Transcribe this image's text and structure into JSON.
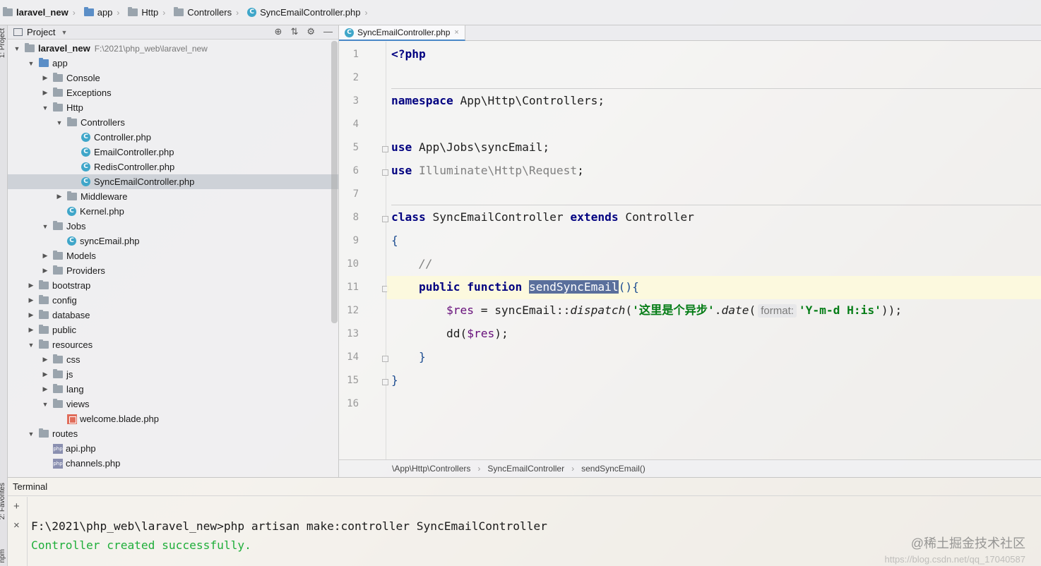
{
  "navbar": {
    "items": [
      "laravel_new",
      "app",
      "Http",
      "Controllers",
      "SyncEmailController.php"
    ]
  },
  "stripe": {
    "top_label": "1: Project",
    "bottom_label": "2: Favorites",
    "bottom_label2": "npm"
  },
  "project": {
    "title": "Project",
    "root_label": "laravel_new",
    "root_path": "F:\\2021\\php_web\\laravel_new",
    "tree": [
      {
        "label": "app",
        "depth": 1,
        "kind": "folder-blue",
        "open": true
      },
      {
        "label": "Console",
        "depth": 2,
        "kind": "folder",
        "open": false
      },
      {
        "label": "Exceptions",
        "depth": 2,
        "kind": "folder",
        "open": false
      },
      {
        "label": "Http",
        "depth": 2,
        "kind": "folder",
        "open": true
      },
      {
        "label": "Controllers",
        "depth": 3,
        "kind": "folder",
        "open": true
      },
      {
        "label": "Controller.php",
        "depth": 4,
        "kind": "php"
      },
      {
        "label": "EmailController.php",
        "depth": 4,
        "kind": "php"
      },
      {
        "label": "RedisController.php",
        "depth": 4,
        "kind": "php"
      },
      {
        "label": "SyncEmailController.php",
        "depth": 4,
        "kind": "php",
        "selected": true
      },
      {
        "label": "Middleware",
        "depth": 3,
        "kind": "folder",
        "open": false
      },
      {
        "label": "Kernel.php",
        "depth": 3,
        "kind": "php"
      },
      {
        "label": "Jobs",
        "depth": 2,
        "kind": "folder",
        "open": true
      },
      {
        "label": "syncEmail.php",
        "depth": 3,
        "kind": "php"
      },
      {
        "label": "Models",
        "depth": 2,
        "kind": "folder",
        "open": false
      },
      {
        "label": "Providers",
        "depth": 2,
        "kind": "folder",
        "open": false
      },
      {
        "label": "bootstrap",
        "depth": 1,
        "kind": "folder",
        "open": false
      },
      {
        "label": "config",
        "depth": 1,
        "kind": "folder",
        "open": false
      },
      {
        "label": "database",
        "depth": 1,
        "kind": "folder",
        "open": false
      },
      {
        "label": "public",
        "depth": 1,
        "kind": "folder",
        "open": false
      },
      {
        "label": "resources",
        "depth": 1,
        "kind": "folder",
        "open": true
      },
      {
        "label": "css",
        "depth": 2,
        "kind": "folder",
        "open": false
      },
      {
        "label": "js",
        "depth": 2,
        "kind": "folder",
        "open": false
      },
      {
        "label": "lang",
        "depth": 2,
        "kind": "folder",
        "open": false
      },
      {
        "label": "views",
        "depth": 2,
        "kind": "folder",
        "open": true
      },
      {
        "label": "welcome.blade.php",
        "depth": 3,
        "kind": "blade"
      },
      {
        "label": "routes",
        "depth": 1,
        "kind": "folder",
        "open": true
      },
      {
        "label": "api.php",
        "depth": 2,
        "kind": "phpfile"
      },
      {
        "label": "channels.php",
        "depth": 2,
        "kind": "phpfile"
      }
    ]
  },
  "editor": {
    "tab_label": "SyncEmailController.php",
    "line_numbers": [
      "1",
      "2",
      "3",
      "4",
      "5",
      "6",
      "7",
      "8",
      "9",
      "10",
      "11",
      "12",
      "13",
      "14",
      "15",
      "16"
    ],
    "code": {
      "l1_php": "<?php",
      "l3_ns_kw": "namespace",
      "l3_ns": " App\\Http\\Controllers;",
      "l5_use": "use",
      "l5_rest": " App\\Jobs\\syncEmail;",
      "l6_use": "use",
      "l6_rest": " Illuminate\\Http\\Request",
      "l6_semi": ";",
      "l8_class": "class",
      "l8_name": " SyncEmailController ",
      "l8_extends": "extends",
      "l8_parent": " Controller",
      "l9": "{",
      "l10": "    //",
      "l11_indent": "    ",
      "l11_public": "public",
      "l11_function": "function",
      "l11_name": "sendSyncEmail",
      "l11_tail": "(){",
      "l12_indent": "        ",
      "l12_var": "$res",
      "l12_eq": " = syncEmail::",
      "l12_dispatch": "dispatch",
      "l12_open": "(",
      "l12_str": "'这里是个异步'",
      "l12_dot": ".",
      "l12_date": "date",
      "l12_paren": "(",
      "l12_hint": "format:",
      "l12_fmt": "'Y-m-d H:is'",
      "l12_close": "));",
      "l13_indent": "        ",
      "l13_dd": "dd(",
      "l13_var": "$res",
      "l13_close": ");",
      "l14": "    }",
      "l15": "}"
    },
    "breadcrumbs": [
      "\\App\\Http\\Controllers",
      "SyncEmailController",
      "sendSyncEmail()"
    ]
  },
  "terminal": {
    "title": "Terminal",
    "command": "F:\\2021\\php_web\\laravel_new>php artisan make:controller SyncEmailController",
    "output": "Controller created successfully.",
    "add_glyph": "+",
    "close_glyph": "×"
  },
  "watermark": {
    "text": "@稀土掘金技术社区",
    "url": "https://blog.csdn.net/qq_17040587"
  },
  "colors": {
    "keyword": "#000080",
    "string": "#067d17",
    "selection": "#5a6f9c",
    "terminal_success": "#1fae3a"
  }
}
